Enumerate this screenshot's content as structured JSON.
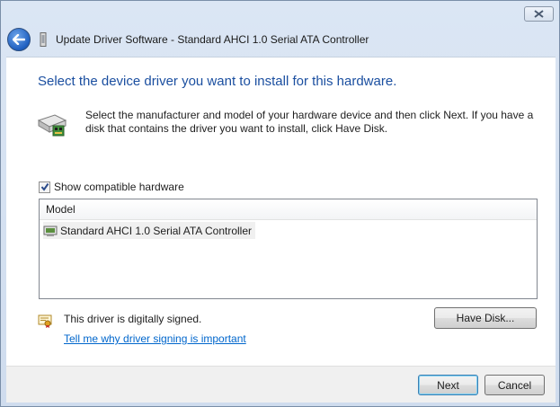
{
  "window": {
    "title": "Update Driver Software - Standard AHCI 1.0 Serial ATA Controller"
  },
  "page": {
    "heading": "Select the device driver you want to install for this hardware.",
    "instruction": "Select the manufacturer and model of your hardware device and then click Next. If you have a disk that contains the driver you want to install, click Have Disk."
  },
  "compatible": {
    "label": "Show compatible hardware",
    "checked": true
  },
  "model_list": {
    "header": "Model",
    "items": [
      "Standard AHCI 1.0 Serial ATA Controller"
    ]
  },
  "signing": {
    "status": "This driver is digitally signed.",
    "link": "Tell me why driver signing is important"
  },
  "buttons": {
    "have_disk": "Have Disk...",
    "next": "Next",
    "cancel": "Cancel"
  },
  "icons": {
    "back": "back-arrow-icon",
    "close": "close-icon",
    "hardware": "hardware-device-icon",
    "driver_row": "driver-icon",
    "certificate": "certificate-icon"
  },
  "colors": {
    "heading": "#1b4fa0",
    "link": "#0066cc",
    "back_button": "#1f5fc0"
  }
}
